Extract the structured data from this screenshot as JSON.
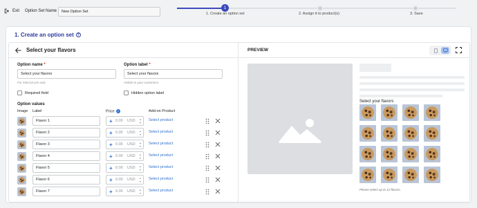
{
  "topbar": {
    "exit_label": "Exit",
    "set_name_label": "Option Set Name",
    "set_name_value": "New Option Set",
    "steps": [
      {
        "number": "1",
        "label": "1. Create an option set"
      },
      {
        "number": "2",
        "label": "2. Assign it to product(s)"
      },
      {
        "number": "3",
        "label": "3. Save"
      }
    ],
    "accent_color": "#3b4bbd"
  },
  "card": {
    "title": "1. Create an option set",
    "help_glyph": "?"
  },
  "editor": {
    "heading": "Select your flavors",
    "option_name_label": "Option name",
    "option_name_value": "Select your flavors",
    "option_name_help": "For internal use only",
    "option_label_label": "Option label",
    "option_label_value": "Select your flavors",
    "option_label_help": "Visible to your customers",
    "required_asterisk": "*",
    "required_field_label": "Required field",
    "hidden_option_label": "Hidden option label",
    "option_values_label": "Option values",
    "columns": {
      "image": "Image",
      "label": "Label",
      "price": "Price",
      "price_info": "?",
      "addon": "Add-on Product"
    },
    "rows": [
      {
        "label": "Flavor 1",
        "price": "0.00",
        "currency": "USD",
        "addon": "Select product"
      },
      {
        "label": "Flavor 2",
        "price": "0.00",
        "currency": "USD",
        "addon": "Select product"
      },
      {
        "label": "Flavor 3",
        "price": "0.00",
        "currency": "USD",
        "addon": "Select product"
      },
      {
        "label": "Flavor 4",
        "price": "0.00",
        "currency": "USD",
        "addon": "Select product"
      },
      {
        "label": "Flavor 5",
        "price": "0.00",
        "currency": "USD",
        "addon": "Select product"
      },
      {
        "label": "Flavor 6",
        "price": "0.00",
        "currency": "USD",
        "addon": "Select product"
      },
      {
        "label": "Flavor 7",
        "price": "0.00",
        "currency": "USD",
        "addon": "Select product"
      }
    ]
  },
  "preview": {
    "title": "PREVIEW",
    "select_title": "Select your flavors",
    "note": "Please select up to 12 flavors."
  }
}
